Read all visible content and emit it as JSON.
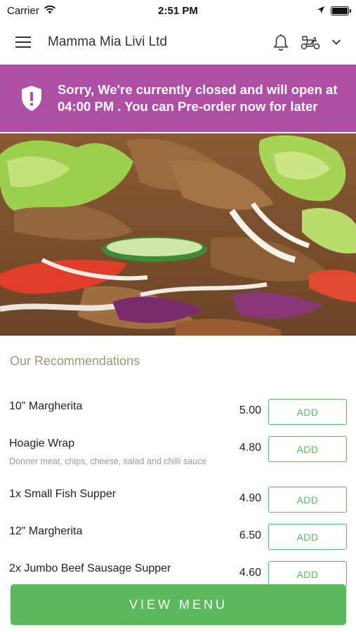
{
  "status_bar": {
    "carrier": "Carrier",
    "time": "2:51 PM"
  },
  "header": {
    "title": "Mamma Mia Livi Ltd",
    "icons": [
      "menu-icon",
      "bell-icon",
      "scooter-icon",
      "chevron-down-icon"
    ]
  },
  "notice": {
    "message": "Sorry, We're currently closed and will open at 04:00 PM . You can Pre-order now for later",
    "icon": "shield-alert-icon",
    "color": "#b04ea6"
  },
  "recommendations": {
    "title": "Our Recommendations",
    "items": [
      {
        "name": "10\" Margherita",
        "description": "",
        "price": "5.00",
        "action": "ADD"
      },
      {
        "name": "Hoagie Wrap",
        "description": "Donner meat, chips, cheese, salad and chilli sauce",
        "price": "4.80",
        "action": "ADD"
      },
      {
        "name": "1x Small Fish Supper",
        "description": "",
        "price": "4.90",
        "action": "ADD"
      },
      {
        "name": "12\" Margherita",
        "description": "",
        "price": "6.50",
        "action": "ADD"
      },
      {
        "name": "2x Jumbo Beef Sausage Supper",
        "description": "",
        "price": "4.60",
        "action": "ADD"
      }
    ]
  },
  "footer": {
    "view_menu_label": "VIEW MENU"
  },
  "colors": {
    "accent_green": "#5cb85c",
    "banner_purple": "#b04ea6",
    "section_title": "#a59473"
  }
}
